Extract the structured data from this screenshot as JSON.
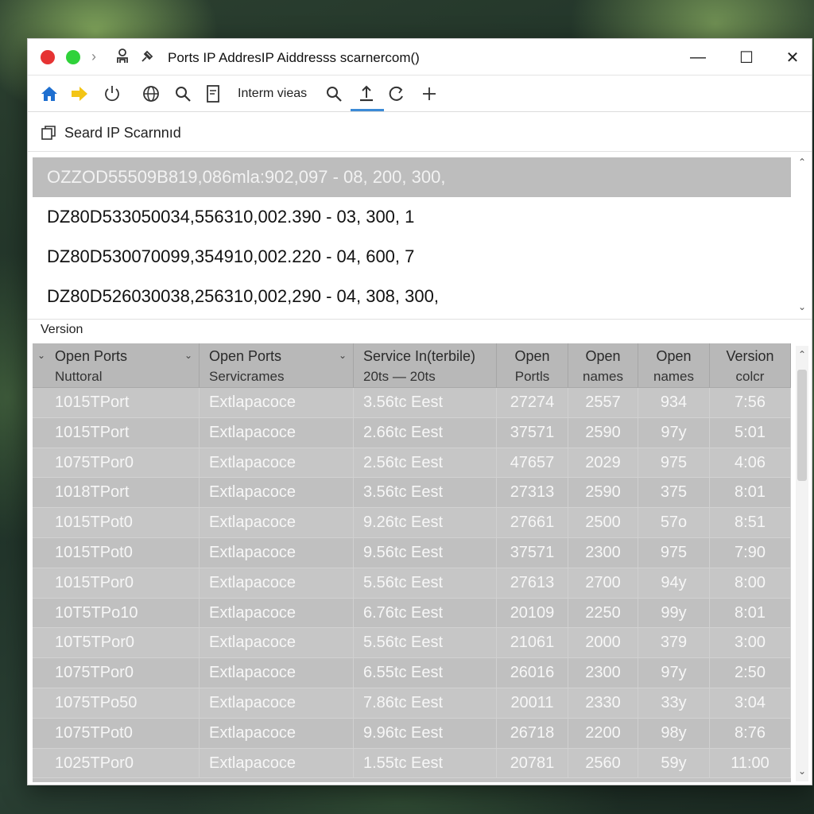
{
  "window": {
    "title": "Ports IP AddresIP Aiddresss scarnercom()",
    "controls": {
      "minimize": "—",
      "maximize": "☐",
      "close": "✕"
    },
    "nav_chevron": "›"
  },
  "toolbar": {
    "text": "Interm vieas",
    "icons": [
      "home-icon",
      "forward-icon",
      "power-icon",
      "globe-icon",
      "search-icon",
      "document-icon",
      "search-icon",
      "upload-icon",
      "refresh-icon",
      "plus-icon"
    ]
  },
  "search": {
    "label": "Seard IP Scarnnıd"
  },
  "results": [
    "OZZOD55509B819,086mla:902,097 - 08, 200, 300,",
    "DZ80D533050034,556310,002.390 - 03, 300, 1",
    "DZ80D530070099,354910,002.220 - 04, 600, 7",
    "DZ80D526030038,256310,002,290 - 04, 308, 300,"
  ],
  "version_label": "Version",
  "table": {
    "columns": [
      {
        "line1": "Open Ports",
        "line2": "Nuttoral"
      },
      {
        "line1": "Open Ports",
        "line2": "Servicrames"
      },
      {
        "line1": "Service In(terbile)",
        "line2": "20ts — 20ts"
      },
      {
        "line1": "Open",
        "line2": "Portls"
      },
      {
        "line1": "Open",
        "line2": "names"
      },
      {
        "line1": "Open",
        "line2": "names"
      },
      {
        "line1": "Version",
        "line2": "colcr"
      }
    ],
    "rows": [
      [
        "1015TPort",
        "Extlapacoce",
        "3.56tc Eest",
        "27274",
        "2557",
        "934",
        "7:56"
      ],
      [
        "1015TPort",
        "Extlapacoce",
        "2.66tc Eest",
        "37571",
        "2590",
        "97y",
        "5:01"
      ],
      [
        "1075TPor0",
        "Extlapacoce",
        "2.56tc Eest",
        "47657",
        "2029",
        "975",
        "4:06"
      ],
      [
        "1018TPort",
        "Extlapacoce",
        "3.56tc Eest",
        "27313",
        "2590",
        "375",
        "8:01"
      ],
      [
        "1015TPot0",
        "Extlapacoce",
        "9.26tc Eest",
        "27661",
        "2500",
        "57o",
        "8:51"
      ],
      [
        "1015TPot0",
        "Extlapacoce",
        "9.56tc Eest",
        "37571",
        "2300",
        "975",
        "7:90"
      ],
      [
        "1015TPor0",
        "Extlapacoce",
        "5.56tc Eest",
        "27613",
        "2700",
        "94y",
        "8:00"
      ],
      [
        "10T5TPo10",
        "Extlapacoce",
        "6.76tc Eest",
        "20109",
        "2250",
        "99y",
        "8:01"
      ],
      [
        "10T5TPor0",
        "Extlapacoce",
        "5.56tc Eest",
        "21061",
        "2000",
        "379",
        "3:00"
      ],
      [
        "1075TPor0",
        "Extlapacoce",
        "6.55tc Eest",
        "26016",
        "2300",
        "97y",
        "2:50"
      ],
      [
        "1075TPo50",
        "Extlapacoce",
        "7.86tc Eest",
        "20011",
        "2330",
        "33y",
        "3:04"
      ],
      [
        "1075TPot0",
        "Extlapacoce",
        "9.96tc Eest",
        "26718",
        "2200",
        "98y",
        "8:76"
      ],
      [
        "1025TPor0",
        "Extlapacoce",
        "1.55tc Eest",
        "20781",
        "2560",
        "59y",
        "11:00"
      ]
    ]
  },
  "colors": {
    "close_dot": "#e63333",
    "max_dot": "#2fd23a",
    "home_icon": "#1e6fd0",
    "forward_icon": "#f3c516",
    "tab_underline": "#3b8ad6",
    "selected_row": "#bdbdbd",
    "table_bg": "#c2c2c2"
  }
}
